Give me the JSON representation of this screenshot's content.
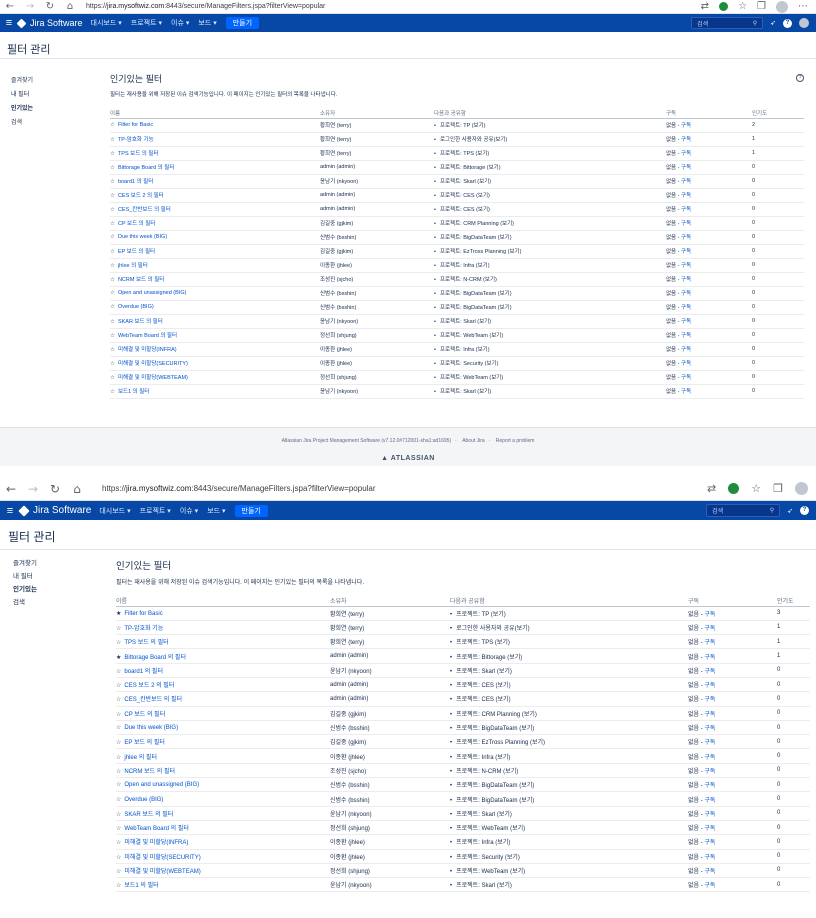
{
  "browser": {
    "url_prefix": "https://",
    "url_host": "jira.mysoftwiz.com",
    "url_rest": ":8443/secure/ManageFilters.jspa?filterView=popular"
  },
  "nav": {
    "product": "Jira Software",
    "menus": [
      "대시보드",
      "프로젝트",
      "이슈",
      "보드"
    ],
    "create": "만들기",
    "search_placeholder": "검색"
  },
  "page": {
    "title": "필터 관리",
    "sidebar": [
      "즐겨찾기",
      "내 필터",
      "인기있는",
      "검색"
    ],
    "section_title": "인기있는 필터",
    "description": "필터는 재사용을 위해 저장된 이슈 검색기능입니다. 이 페이지는 인기있는 필터의 목록을 나타냅니다.",
    "columns": [
      "이름",
      "소유자",
      "다음과 공유함",
      "구독",
      "인기도"
    ],
    "subscribe_none": "없음",
    "subscribe_link": "구독",
    "rows": [
      {
        "name": "Filter for Basic",
        "owner": "황희연 (terry)",
        "shared": "프로젝트: TP (보기)",
        "pop1": "2",
        "pop2": "3",
        "fav2": true
      },
      {
        "name": "TP-암호화 기능",
        "owner": "황희연 (terry)",
        "shared": "로그인한 사용자와 공유(보기)",
        "pop1": "1",
        "pop2": "1",
        "fav2": false
      },
      {
        "name": "TPS 보드 의 필터",
        "owner": "황희연 (terry)",
        "shared": "프로젝트: TPS (보기)",
        "pop1": "1",
        "pop2": "1",
        "fav2": false
      },
      {
        "name": "Bittorage Board 의 필터",
        "owner": "admin (admin)",
        "shared": "프로젝트: Bittorage (보기)",
        "pop1": "0",
        "pop2": "1",
        "fav2": true
      },
      {
        "name": "board1 의 필터",
        "owner": "윤남기 (nkyoon)",
        "shared": "프로젝트: Skarl (보기)",
        "pop1": "0",
        "pop2": "0",
        "fav2": false
      },
      {
        "name": "CES 보드 2 의 필터",
        "owner": "admin (admin)",
        "shared": "프로젝트: CES (보기)",
        "pop1": "0",
        "pop2": "0",
        "fav2": false
      },
      {
        "name": "CES_칸반보드 의 필터",
        "owner": "admin (admin)",
        "shared": "프로젝트: CES (보기)",
        "pop1": "0",
        "pop2": "0",
        "fav2": false
      },
      {
        "name": "CP 보드 의 필터",
        "owner": "김길중 (gjkim)",
        "shared": "프로젝트: CRM Planning (보기)",
        "pop1": "0",
        "pop2": "0",
        "fav2": false
      },
      {
        "name": "Due this week (BIG)",
        "owner": "신범수 (bsshin)",
        "shared": "프로젝트: BigDataTeam (보기)",
        "pop1": "0",
        "pop2": "0",
        "fav2": false
      },
      {
        "name": "EP 보드 의 필터",
        "owner": "김길중 (gjkim)",
        "shared": "프로젝트: EzTross Planning (보기)",
        "pop1": "0",
        "pop2": "0",
        "fav2": false
      },
      {
        "name": "jhlee 의 필터",
        "owner": "이종환 (jhlee)",
        "shared": "프로젝트: Infra (보기)",
        "pop1": "0",
        "pop2": "0",
        "fav2": false
      },
      {
        "name": "NCRM 보드 의 필터",
        "owner": "조성진 (sjcho)",
        "shared": "프로젝트: N-CRM (보기)",
        "pop1": "0",
        "pop2": "0",
        "fav2": false
      },
      {
        "name": "Open and unassigned (BIG)",
        "owner": "신범수 (bsshin)",
        "shared": "프로젝트: BigDataTeam (보기)",
        "pop1": "0",
        "pop2": "0",
        "fav2": false
      },
      {
        "name": "Overdue (BIG)",
        "owner": "신범수 (bsshin)",
        "shared": "프로젝트: BigDataTeam (보기)",
        "pop1": "0",
        "pop2": "0",
        "fav2": false
      },
      {
        "name": "SKAR 보드 의 필터",
        "owner": "윤남기 (nkyoon)",
        "shared": "프로젝트: Skarl (보기)",
        "pop1": "0",
        "pop2": "0",
        "fav2": false
      },
      {
        "name": "WebTeam Board 의 필터",
        "owner": "정선희 (shjung)",
        "shared": "프로젝트: WebTeam (보기)",
        "pop1": "0",
        "pop2": "0",
        "fav2": false
      },
      {
        "name": "미해결 및 미할당(INFRA)",
        "owner": "이종환 (jhlee)",
        "shared": "프로젝트: Infra (보기)",
        "pop1": "0",
        "pop2": "0",
        "fav2": false
      },
      {
        "name": "미해결 및 미할당(SECURITY)",
        "owner": "이종환 (jhlee)",
        "shared": "프로젝트: Security (보기)",
        "pop1": "0",
        "pop2": "0",
        "fav2": false
      },
      {
        "name": "미해결 및 미할당(WEBTEAM)",
        "owner": "정선희 (shjung)",
        "shared": "프로젝트: WebTeam (보기)",
        "pop1": "0",
        "pop2": "0",
        "fav2": false
      },
      {
        "name": "보드1 의 필터",
        "owner": "윤남기 (nkyoon)",
        "shared": "프로젝트: Skarl (보기)",
        "pop1": "0",
        "pop2": "0",
        "fav2": false
      }
    ]
  },
  "footer": {
    "version": "Atlassian Jira Project Management Software (v7.12.0#712001-sha1:ad1695)",
    "about": "About Jira",
    "report": "Report a problem",
    "brand": "ATLASSIAN"
  },
  "colors": {
    "nav_bg": "#0747a6",
    "link": "#0052cc",
    "create_btn": "#0065ff"
  }
}
